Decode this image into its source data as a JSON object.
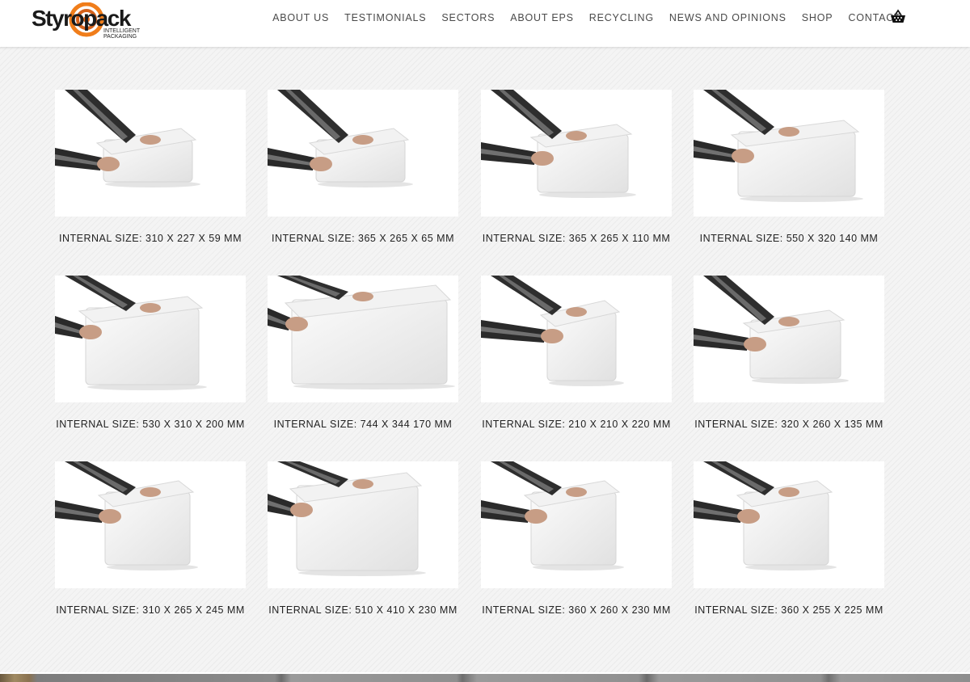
{
  "brand": {
    "name": "Styropack",
    "tagline_line1": "INTELLIGENT",
    "tagline_line2": "PACKAGING",
    "accent_color": "#f07d1a",
    "accent_dark": "#d4611a"
  },
  "nav": {
    "items": [
      {
        "label": "ABOUT US"
      },
      {
        "label": "TESTIMONIALS"
      },
      {
        "label": "SECTORS"
      },
      {
        "label": "ABOUT EPS"
      },
      {
        "label": "RECYCLING"
      },
      {
        "label": "NEWS AND OPINIONS"
      },
      {
        "label": "SHOP"
      },
      {
        "label": "CONTACT"
      }
    ],
    "cart_icon": "basket-icon"
  },
  "products": [
    {
      "caption": "INTERNAL SIZE: 310 X 227 X 59 MM",
      "shape": "flat"
    },
    {
      "caption": "INTERNAL SIZE: 365 X 265 X 65 MM",
      "shape": "flat"
    },
    {
      "caption": "INTERNAL SIZE: 365 X 265 X 110 MM",
      "shape": "medium"
    },
    {
      "caption": "INTERNAL SIZE: 550 X 320 140 MM",
      "shape": "wide"
    },
    {
      "caption": "INTERNAL SIZE: 530 X 310 X 200 MM",
      "shape": "wide-tall"
    },
    {
      "caption": "INTERNAL SIZE: 744 X 344 170 MM",
      "shape": "long"
    },
    {
      "caption": "INTERNAL SIZE: 210 X 210 X 220 MM",
      "shape": "cube"
    },
    {
      "caption": "INTERNAL SIZE: 320 X 260 X 135 MM",
      "shape": "medium"
    },
    {
      "caption": "INTERNAL SIZE: 310 X 265 X 245 MM",
      "shape": "tall"
    },
    {
      "caption": "INTERNAL SIZE: 510 X 410 X 230 MM",
      "shape": "big"
    },
    {
      "caption": "INTERNAL SIZE: 360 X 260 X 230 MM",
      "shape": "tall"
    },
    {
      "caption": "INTERNAL SIZE: 360 X 255 X 225 MM",
      "shape": "tall"
    }
  ]
}
